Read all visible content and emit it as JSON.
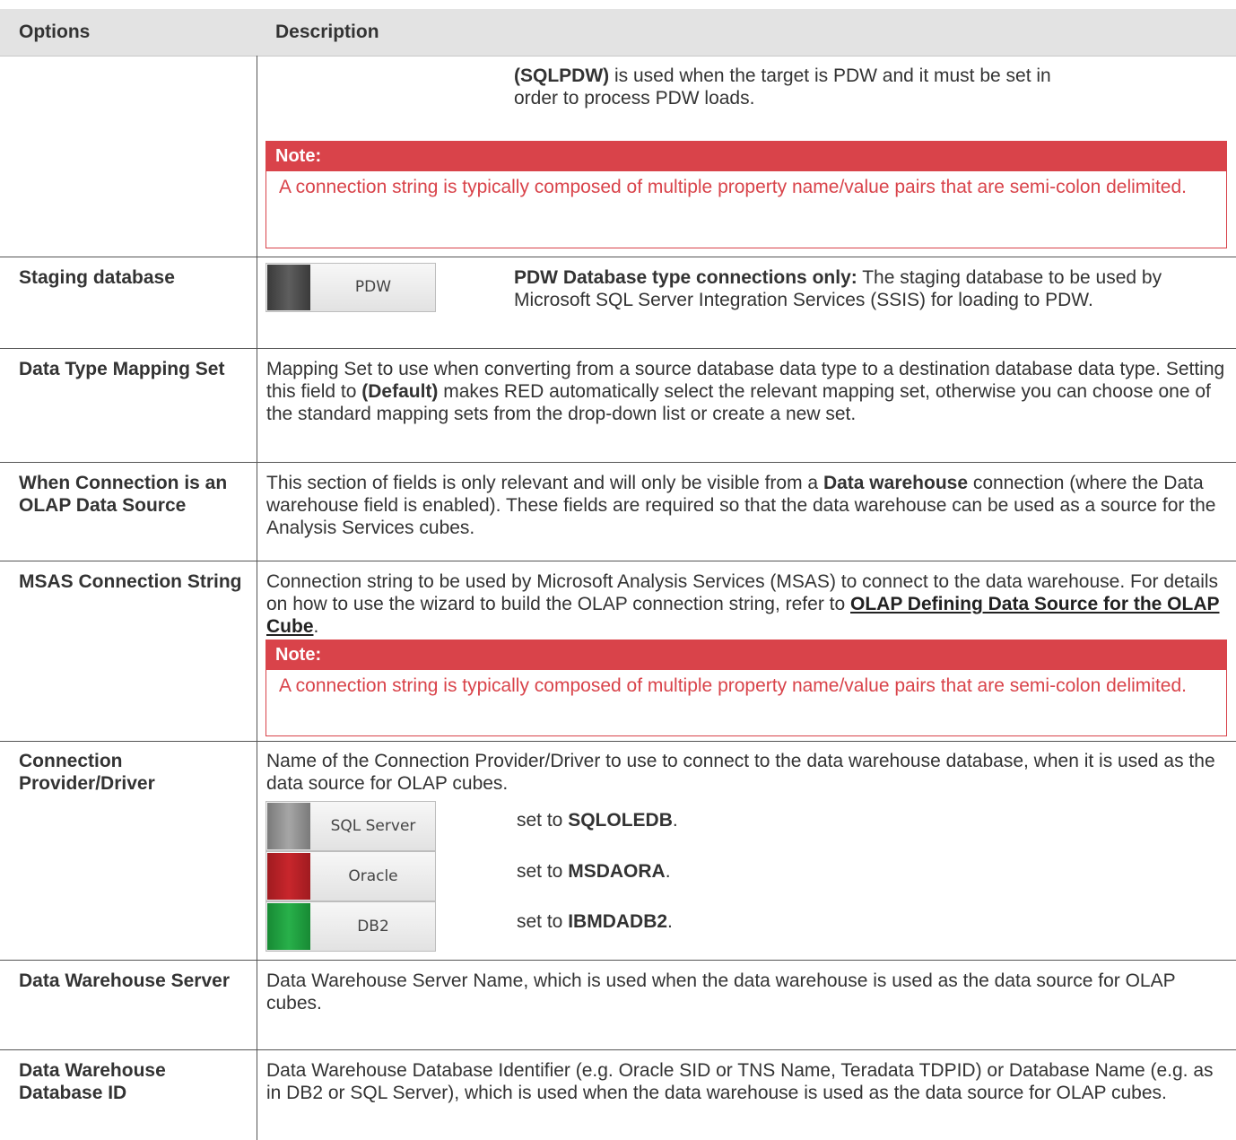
{
  "header": {
    "col1": "Options",
    "col2": "Description"
  },
  "row0": {
    "line1_bold": "(SQLPDW)",
    "line1_rest": " is used when the target is PDW and it must be set in",
    "line2": "order to process PDW loads.",
    "note_title": "Note:",
    "note_text": " A connection string is typically composed of multiple property name/value pairs that are semi-colon delimited."
  },
  "staging": {
    "option": "Staging database",
    "button_label": "PDW",
    "desc_bold": "PDW Database type connections only:",
    "desc_rest": " The staging database to be used by Microsoft SQL Server Integration Services (SSIS) for loading to PDW."
  },
  "mapping": {
    "option": "Data Type Mapping Set",
    "desc_a": " Mapping Set to use when converting from a source database data type to a destination database data type. Setting this field to ",
    "desc_bold": "(Default)",
    "desc_b": " makes RED automatically select the relevant mapping set, otherwise you can choose one of the standard mapping sets from the drop-down list or create a new set."
  },
  "olap": {
    "option": "When Connection is an OLAP Data Source",
    "desc_a": " This section of fields is only relevant and will only be visible from a ",
    "desc_bold": "Data warehouse",
    "desc_b": " connection (where the Data warehouse field is enabled). These fields are required so that the data warehouse can be used as a source for the Analysis Services cubes."
  },
  "msas": {
    "option": "MSAS Connection String",
    "desc_a": " Connection string to be used by Microsoft Analysis Services (MSAS) to connect to the data warehouse. For details on how to use the wizard to build the OLAP connection string, refer to ",
    "link": "OLAP Defining Data Source for the OLAP Cube",
    "desc_b": ".",
    "note_title": "Note:",
    "note_text": " A connection string is typically composed of multiple property name/value pairs that are semi-colon delimited."
  },
  "provider": {
    "option": "Connection Provider/Driver",
    "desc": " Name of the Connection Provider/Driver to use to connect to the data warehouse database, when it is used as the data source for OLAP cubes.",
    "items": [
      {
        "label": "SQL Server",
        "color": "#8c8c8c",
        "prefix": " set to ",
        "value": "SQLOLEDB",
        "suffix": "."
      },
      {
        "label": "Oracle",
        "color": "#b21f24",
        "prefix": "set to ",
        "value": "MSDAORA",
        "suffix": "."
      },
      {
        "label": "DB2",
        "color": "#1e9e3e",
        "prefix": "set to ",
        "value": "IBMDADB2",
        "suffix": "."
      }
    ]
  },
  "dwserver": {
    "option": "Data Warehouse Server",
    "desc": " Data Warehouse Server Name, which is used when the data warehouse is used as the data source for OLAP cubes."
  },
  "dwdbid": {
    "option": "Data Warehouse Database ID",
    "desc": " Data Warehouse Database Identifier (e.g. Oracle SID or TNS Name, Teradata TDPID) or Database Name (e.g. as in DB2 or SQL Server), which is used when the data warehouse is used as the data source for OLAP cubes."
  },
  "colors": {
    "header_bg": "#e3e3e3",
    "note_red": "#d9434a",
    "pdw_swatch": "#4a4a4a"
  }
}
